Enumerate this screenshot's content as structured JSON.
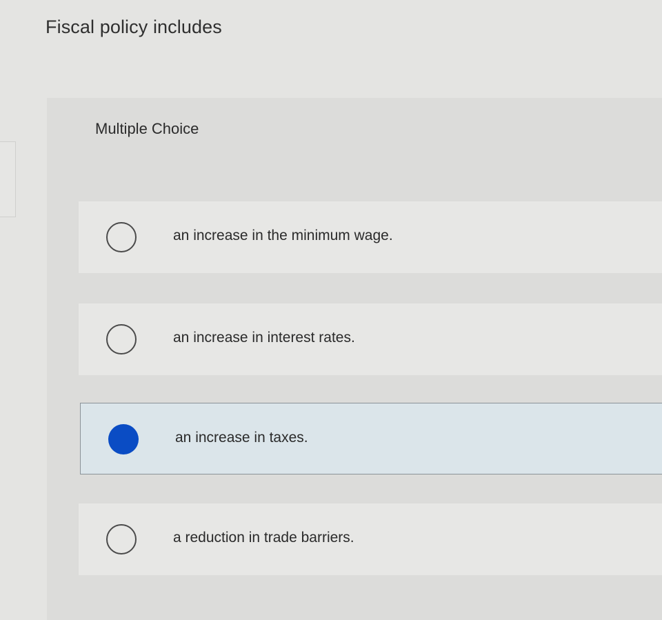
{
  "question": {
    "text": "Fiscal policy includes"
  },
  "panel": {
    "label": "Multiple Choice"
  },
  "options": [
    {
      "label": "an increase in the minimum wage.",
      "selected": false
    },
    {
      "label": "an increase in interest rates.",
      "selected": false
    },
    {
      "label": "an increase in taxes.",
      "selected": true
    },
    {
      "label": "a reduction in trade barriers.",
      "selected": false
    }
  ],
  "colors": {
    "selected_radio": "#0a4cc4",
    "selected_background": "#dbe5ea"
  }
}
